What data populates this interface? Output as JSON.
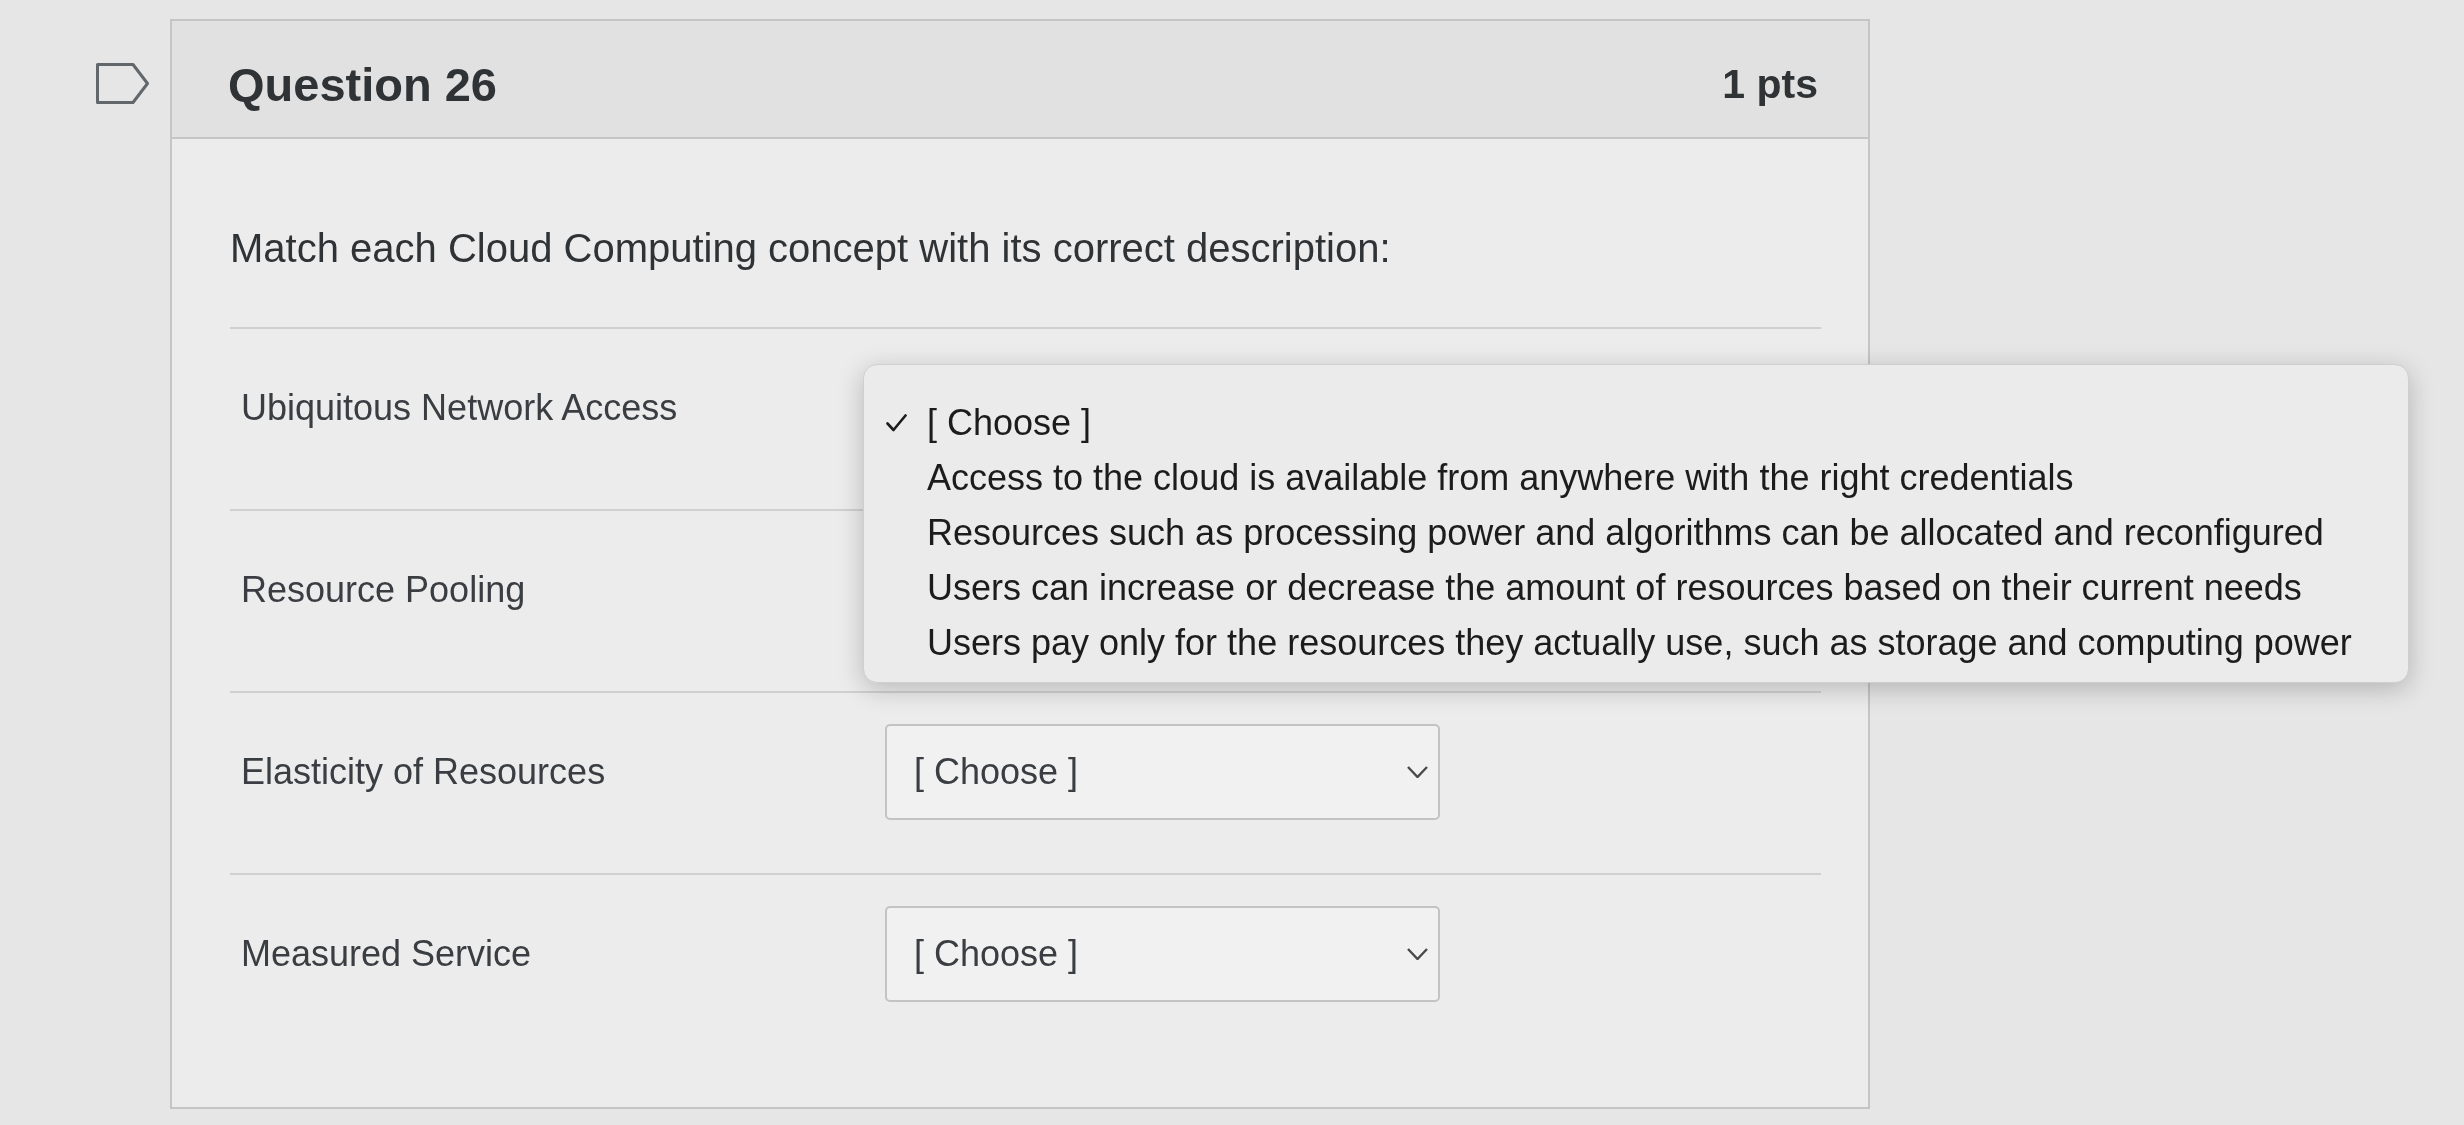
{
  "question": {
    "flagged": false,
    "title": "Question 26",
    "points": "1 pts",
    "prompt": "Match each Cloud Computing concept with its correct description:",
    "rows": [
      {
        "label": "Ubiquitous Network Access",
        "select": {
          "expanded": true,
          "options": [
            {
              "label": "[ Choose ]",
              "selected": true
            },
            {
              "label": "Access to the cloud is available from anywhere with the right credentials",
              "selected": false
            },
            {
              "label": "Resources such as processing power and algorithms can be allocated and reconfigured",
              "selected": false
            },
            {
              "label": "Users can increase or decrease the amount of resources based on their current needs",
              "selected": false
            },
            {
              "label": "Users pay only for the resources they actually use, such as storage and computing power",
              "selected": false
            }
          ]
        }
      },
      {
        "label": "Resource Pooling"
      },
      {
        "label": "Elasticity of Resources",
        "select": {
          "expanded": false,
          "value": "[ Choose ]"
        }
      },
      {
        "label": "Measured Service",
        "select": {
          "expanded": false,
          "value": "[ Choose ]"
        }
      }
    ]
  }
}
